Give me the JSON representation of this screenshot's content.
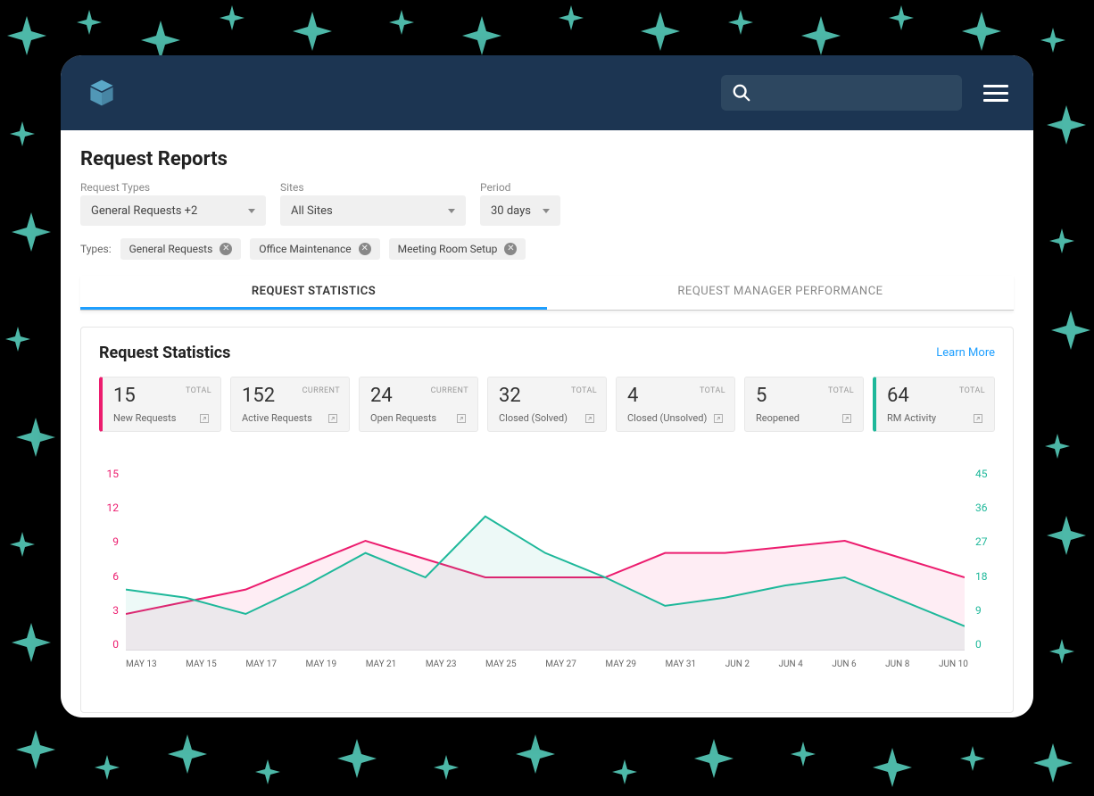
{
  "page_title": "Request Reports",
  "filters": {
    "request_types": {
      "label": "Request Types",
      "value": "General Requests +2"
    },
    "sites": {
      "label": "Sites",
      "value": "All Sites"
    },
    "period": {
      "label": "Period",
      "value": "30 days"
    }
  },
  "chips": {
    "label": "Types:",
    "items": [
      "General Requests",
      "Office Maintenance",
      "Meeting Room Setup"
    ]
  },
  "tabs": {
    "active": "REQUEST STATISTICS",
    "inactive": "REQUEST MANAGER PERFORMANCE"
  },
  "stats": {
    "title": "Request Statistics",
    "learn_more": "Learn More",
    "cards": [
      {
        "value": "15",
        "tag": "TOTAL",
        "name": "New Requests",
        "accent": "pink"
      },
      {
        "value": "152",
        "tag": "CURRENT",
        "name": "Active Requests"
      },
      {
        "value": "24",
        "tag": "CURRENT",
        "name": "Open Requests"
      },
      {
        "value": "32",
        "tag": "TOTAL",
        "name": "Closed (Solved)"
      },
      {
        "value": "4",
        "tag": "TOTAL",
        "name": "Closed (Unsolved)"
      },
      {
        "value": "5",
        "tag": "TOTAL",
        "name": "Reopened"
      },
      {
        "value": "64",
        "tag": "TOTAL",
        "name": "RM Activity",
        "accent": "teal"
      }
    ]
  },
  "chart_data": {
    "type": "line",
    "x_labels": [
      "MAY 13",
      "MAY 15",
      "MAY 17",
      "MAY 19",
      "MAY 21",
      "MAY 23",
      "MAY 25",
      "MAY 27",
      "MAY 29",
      "MAY 31",
      "JUN 2",
      "JUN 4",
      "JUN 6",
      "JUN 8",
      "JUN 10"
    ],
    "y_left": {
      "label": "",
      "ticks": [
        15,
        12,
        9,
        6,
        3,
        0
      ],
      "range": [
        0,
        15
      ],
      "color": "#ec1c6e"
    },
    "y_right": {
      "label": "",
      "ticks": [
        45,
        36,
        27,
        18,
        9,
        0
      ],
      "range": [
        0,
        45
      ],
      "color": "#1eb89a"
    },
    "series": [
      {
        "name": "New Requests",
        "axis": "left",
        "color": "#ec1c6e",
        "values": [
          3,
          4,
          5,
          7,
          9,
          7.5,
          6,
          6,
          6,
          8,
          8,
          8.5,
          9,
          7.5,
          6
        ]
      },
      {
        "name": "RM Activity",
        "axis": "right",
        "color": "#1eb89a",
        "values": [
          15,
          13,
          9,
          16,
          24,
          18,
          33,
          24,
          18,
          11,
          13,
          16,
          18,
          12,
          6
        ]
      }
    ]
  }
}
